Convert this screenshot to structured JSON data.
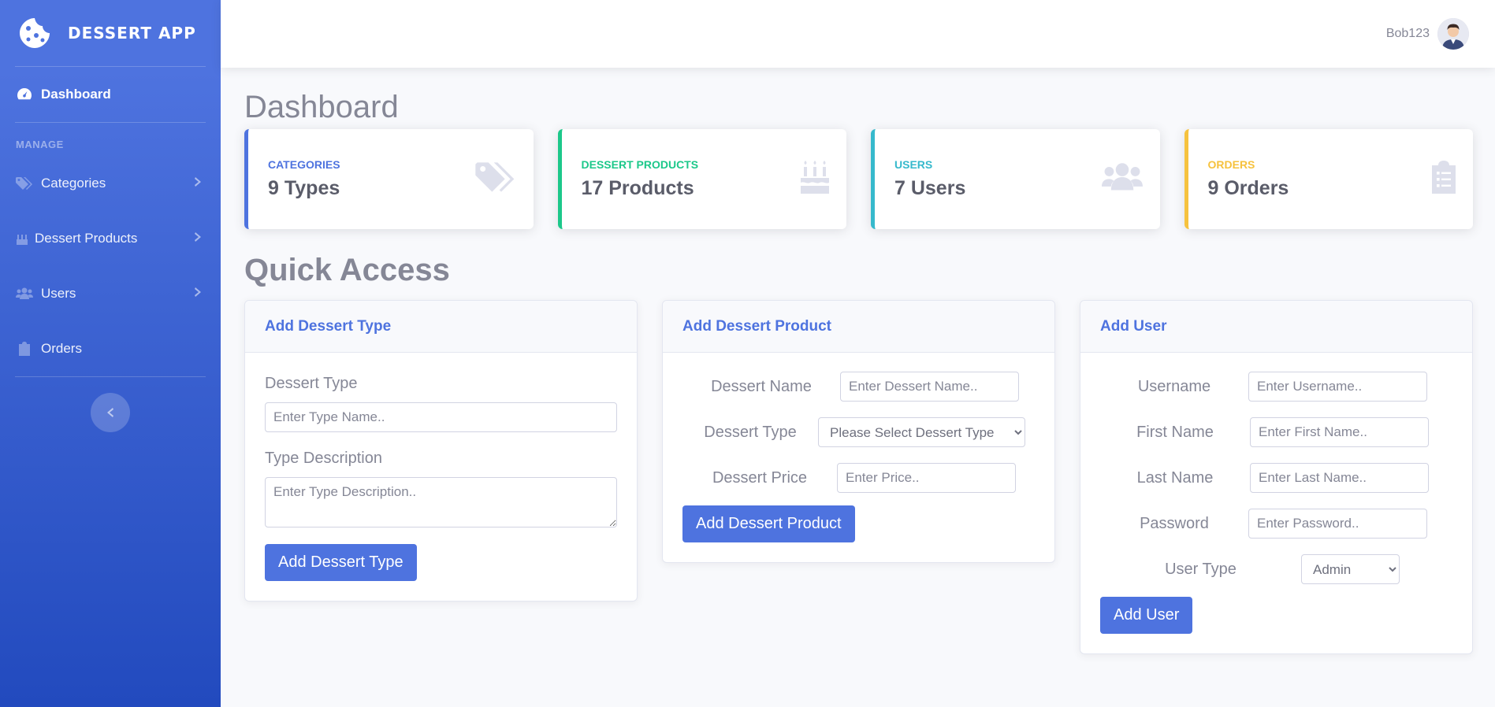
{
  "brand": {
    "name": "DESSERT APP"
  },
  "sidebar": {
    "dashboard": "Dashboard",
    "heading": "MANAGE",
    "items": [
      {
        "label": "Categories",
        "icon": "tags-icon"
      },
      {
        "label": "Dessert Products",
        "icon": "cake-icon"
      },
      {
        "label": "Users",
        "icon": "users-icon"
      },
      {
        "label": "Orders",
        "icon": "clipboard-icon"
      }
    ]
  },
  "topbar": {
    "username": "Bob123"
  },
  "page": {
    "title": "Dashboard",
    "quick_access": "Quick Access"
  },
  "stats": [
    {
      "label": "CATEGORIES",
      "value": "9 Types",
      "color": "#4e73df",
      "icon": "tags-icon"
    },
    {
      "label": "DESSERT PRODUCTS",
      "value": "17 Products",
      "color": "#1cc88a",
      "icon": "birthday-cake-icon"
    },
    {
      "label": "USERS",
      "value": "7 Users",
      "color": "#36b9cc",
      "icon": "users-icon"
    },
    {
      "label": "ORDERS",
      "value": "9 Orders",
      "color": "#f6c23e",
      "icon": "clipboard-list-icon"
    }
  ],
  "forms": {
    "type": {
      "title": "Add Dessert Type",
      "type_label": "Dessert Type",
      "type_placeholder": "Enter Type Name..",
      "desc_label": "Type Description",
      "desc_placeholder": "Enter Type Description..",
      "button": "Add Dessert Type"
    },
    "product": {
      "title": "Add Dessert Product",
      "name_label": "Dessert Name",
      "name_placeholder": "Enter Dessert Name..",
      "type_label": "Dessert Type",
      "type_selected": "Please Select Dessert Type",
      "price_label": "Dessert Price",
      "price_placeholder": "Enter Price..",
      "button": "Add Dessert Product"
    },
    "user": {
      "title": "Add User",
      "username_label": "Username",
      "username_placeholder": "Enter Username..",
      "first_label": "First Name",
      "first_placeholder": "Enter First Name..",
      "last_label": "Last Name",
      "last_placeholder": "Enter Last Name..",
      "password_label": "Password",
      "password_placeholder": "Enter Password..",
      "usertype_label": "User Type",
      "usertype_selected": "Admin",
      "button": "Add User"
    }
  },
  "colors": {
    "primary": "#4e73df",
    "success": "#1cc88a",
    "info": "#36b9cc",
    "warning": "#f6c23e"
  }
}
